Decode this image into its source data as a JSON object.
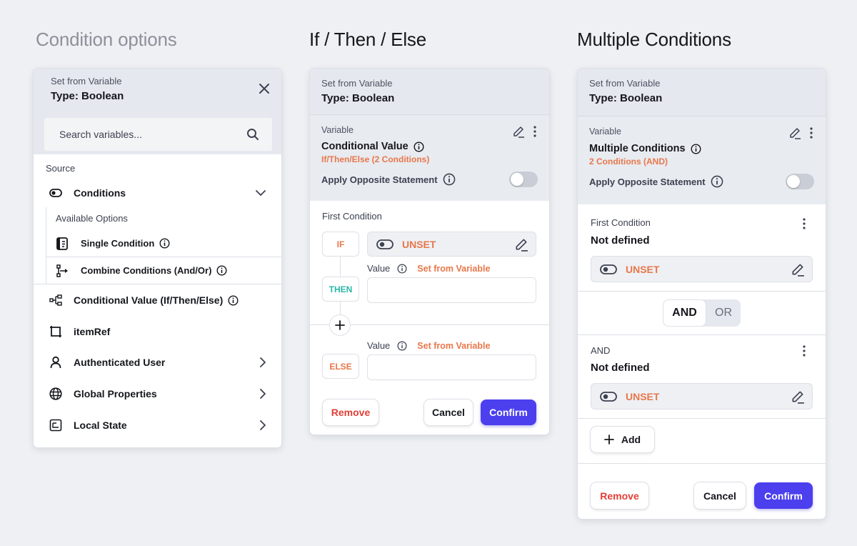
{
  "headings": {
    "condition_options": "Condition options",
    "if_then_else": "If / Then / Else",
    "multiple_conditions": "Multiple Conditions"
  },
  "panel1": {
    "set_from": "Set from Variable",
    "type": "Type: Boolean",
    "search_placeholder": "Search variables...",
    "source_label": "Source",
    "conditions": "Conditions",
    "available_options": "Available Options",
    "single_condition": "Single Condition",
    "combine_conditions": "Combine Conditions (And/Or)",
    "conditional_value": "Conditional Value (If/Then/Else)",
    "item_ref": "itemRef",
    "authenticated_user": "Authenticated User",
    "global_properties": "Global Properties",
    "local_state": "Local State"
  },
  "panel2": {
    "set_from": "Set from Variable",
    "type": "Type: Boolean",
    "variable_label": "Variable",
    "variable_name": "Conditional Value",
    "variable_sub": "If/Then/Else (2 Conditions)",
    "apply_opposite": "Apply Opposite Statement",
    "first_condition": "First Condition",
    "if_label": "IF",
    "then_label": "THEN",
    "else_label": "ELSE",
    "unset": "UNSET",
    "value_label": "Value",
    "set_from_variable_link": "Set from Variable",
    "remove": "Remove",
    "cancel": "Cancel",
    "confirm": "Confirm"
  },
  "panel3": {
    "set_from": "Set from Variable",
    "type": "Type: Boolean",
    "variable_label": "Variable",
    "variable_name": "Multiple Conditions",
    "variable_sub": "2 Conditions (AND)",
    "apply_opposite": "Apply Opposite Statement",
    "first_condition": "First Condition",
    "not_defined_1": "Not defined",
    "unset_1": "UNSET",
    "and_option": "AND",
    "or_option": "OR",
    "and_label": "AND",
    "not_defined_2": "Not defined",
    "unset_2": "UNSET",
    "add": "Add",
    "remove": "Remove",
    "cancel": "Cancel",
    "confirm": "Confirm"
  },
  "colors": {
    "accent": "#4b3fee",
    "orange": "#e8774a",
    "teal": "#27b7a6",
    "danger": "#e53e35"
  }
}
